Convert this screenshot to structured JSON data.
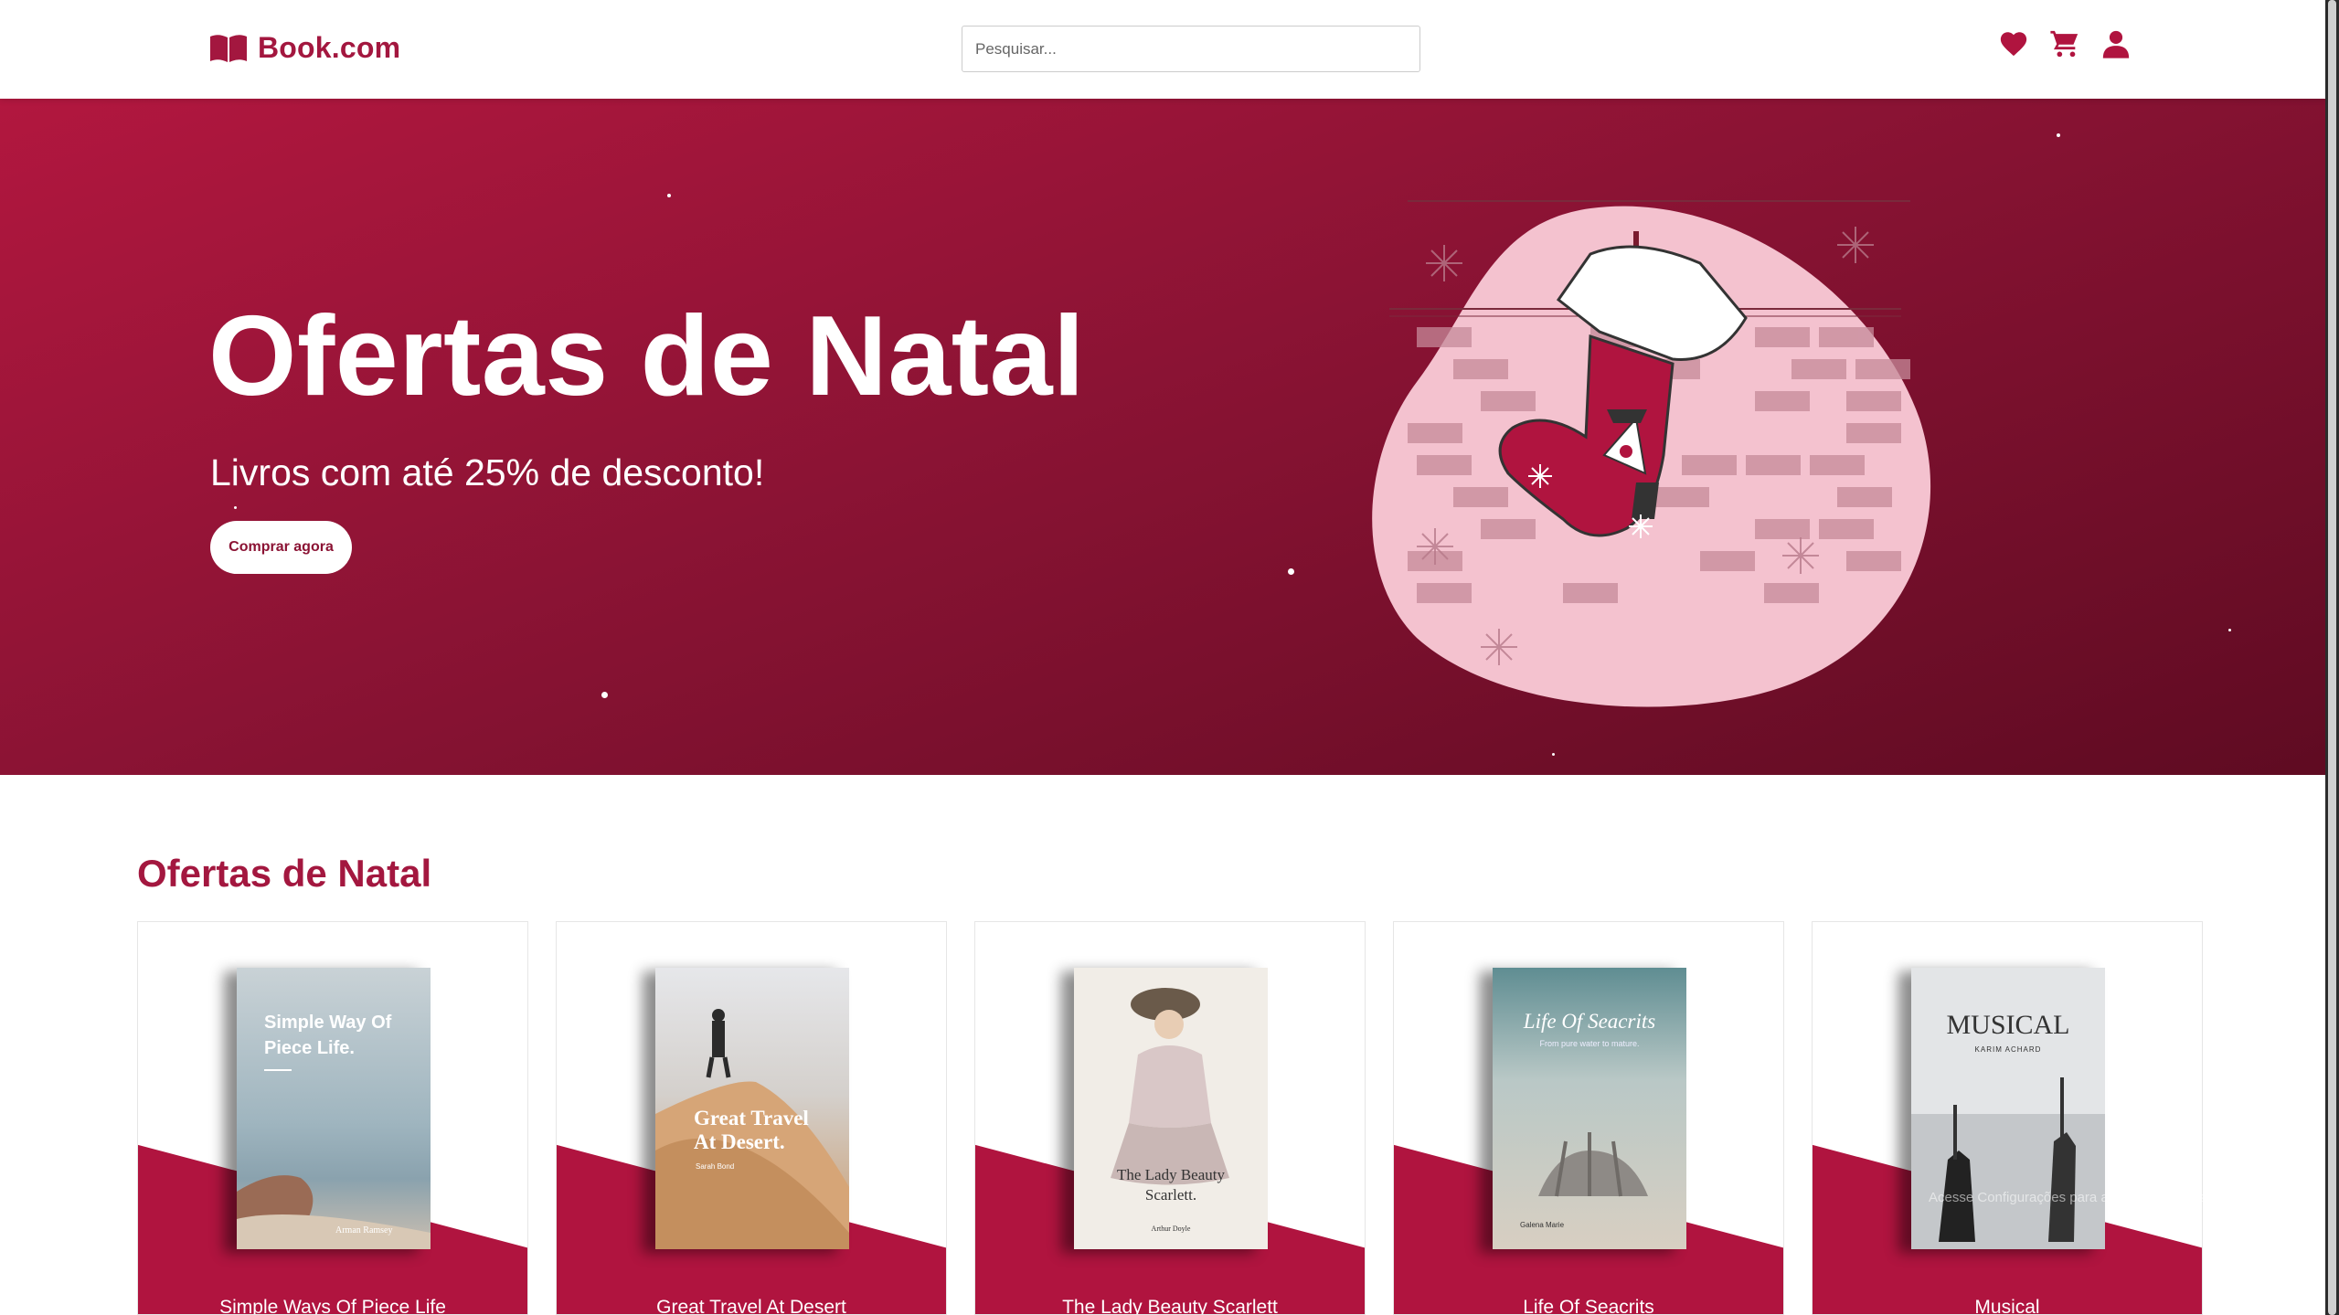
{
  "header": {
    "logo_text": "Book.com",
    "logo_icon": "open-book-icon",
    "search_placeholder": "Pesquisar...",
    "icons": [
      "heart-icon",
      "cart-icon",
      "user-icon"
    ]
  },
  "hero": {
    "title": "Ofertas de Natal",
    "subtitle": "Livros com até 25% de desconto!",
    "button_label": "Comprar agora",
    "illustration": "christmas-stocking-illustration"
  },
  "offers": {
    "title": "Ofertas de Natal",
    "books": [
      {
        "title": "Simple Ways Of Piece Life",
        "cover_title": "Simple Way Of Piece Life.",
        "cover_author": "Arman Ramsey"
      },
      {
        "title": "Great Travel At Desert",
        "cover_title": "Great Travel At Desert.",
        "cover_author": "Sarah Bond"
      },
      {
        "title": "The Lady Beauty Scarlett",
        "cover_title": "The Lady Beauty Scarlett.",
        "cover_author": "Arthur Doyle"
      },
      {
        "title": "Life Of Seacrits",
        "cover_title": "Life Of Seacrits",
        "cover_subtitle": "From pure water to mature.",
        "cover_author": "Galena Marie"
      },
      {
        "title": "Musical",
        "cover_title": "MUSICAL",
        "cover_author": "KARIM ACHARD"
      }
    ]
  },
  "os_watermark": "Acesse Configurações para ativar o Windows.",
  "colors": {
    "brand": "#a3173f",
    "hero_start": "#b2173f",
    "hero_end": "#5f0b22",
    "card_band": "#b0143f"
  }
}
